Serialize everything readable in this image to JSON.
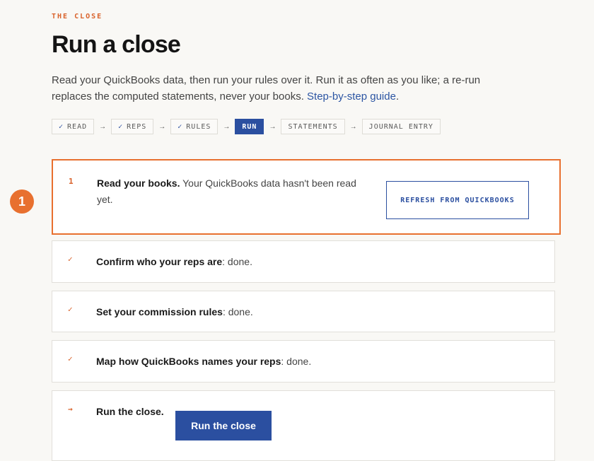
{
  "eyebrow": "THE CLOSE",
  "title": "Run a close",
  "intro": {
    "text": "Read your QuickBooks data, then run your rules over it. Run it as often as you like; a re-run replaces the computed statements, never your books.",
    "link": "Step-by-step guide",
    "link_suffix": "."
  },
  "steps": [
    {
      "label": "READ",
      "check": "✓",
      "state": "done"
    },
    {
      "label": "REPS",
      "check": "✓",
      "state": "done"
    },
    {
      "label": "RULES",
      "check": "✓",
      "state": "done"
    },
    {
      "label": "RUN",
      "state": "active"
    },
    {
      "label": "STATEMENTS",
      "state": "todo"
    },
    {
      "label": "JOURNAL ENTRY",
      "state": "todo"
    }
  ],
  "step_arrow": "→",
  "cards": {
    "read": {
      "marker": "1",
      "title": "Read your books.",
      "body": " Your QuickBooks data hasn't been read yet.",
      "button": "REFRESH FROM QUICKBOOKS"
    },
    "reps": {
      "marker": "✓",
      "title": "Confirm who your reps are",
      "body": ": done."
    },
    "rules": {
      "marker": "✓",
      "title": "Set your commission rules",
      "body": ": done."
    },
    "map": {
      "marker": "✓",
      "title": "Map how QuickBooks names your reps",
      "body": ": done."
    },
    "run": {
      "marker": "→",
      "title": "Run the close.",
      "button": "Run the close"
    }
  },
  "annotation_badge": "1",
  "colors": {
    "accent": "#e8702f",
    "primary": "#2b4fa0",
    "background": "#f9f8f5"
  }
}
